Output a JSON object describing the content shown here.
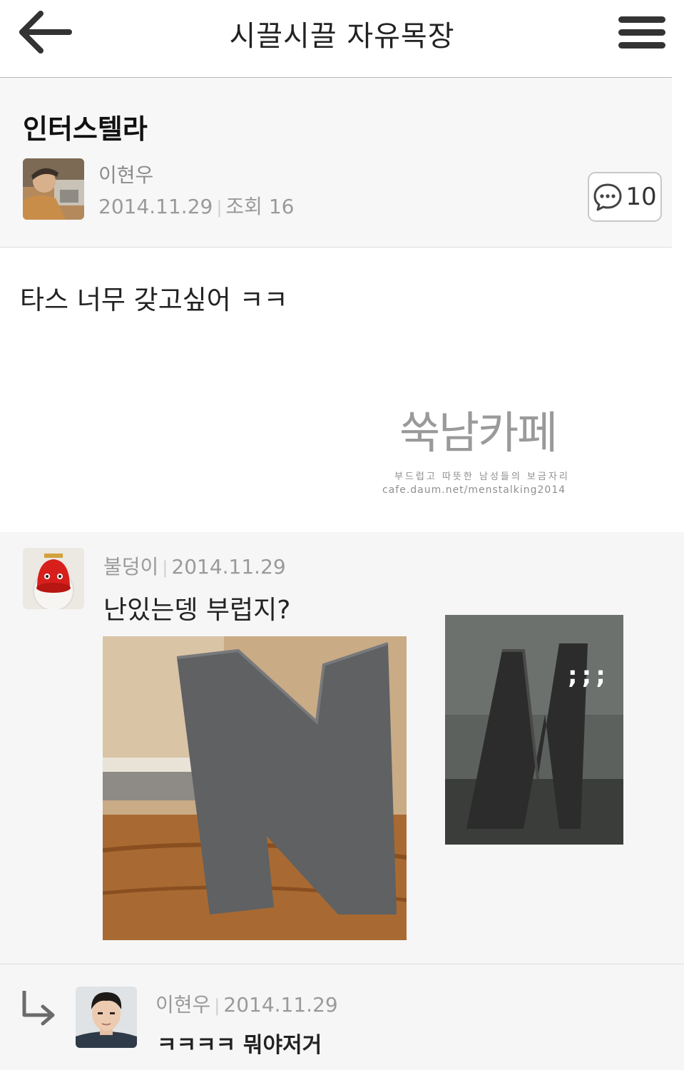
{
  "header": {
    "title": "시끌시끌 자유목장",
    "back_icon": "arrow-left-icon",
    "menu_icon": "hamburger-menu-icon"
  },
  "post": {
    "title": "인터스텔라",
    "author": "이현우",
    "date": "2014.11.29",
    "views_label": "조회 16",
    "comment_count": "10",
    "body": "타스 너무 갖고싶어 ㅋㅋ",
    "watermark": {
      "logo": "쑥남카페",
      "slogan": "부드럽고 따뜻한 남성들의 보금자리",
      "url": "cafe.daum.net/menstalking2014"
    }
  },
  "comments": [
    {
      "author": "불덩이",
      "date": "2014.11.29",
      "text": "난있는뎅 부럽지?",
      "image_caption": ";;;"
    }
  ],
  "replies": [
    {
      "author": "이현우",
      "date": "2014.11.29",
      "text": "ㅋㅋㅋㅋ 뭐야저거"
    }
  ],
  "colors": {
    "header_bg": "#ffffff",
    "post_head_bg": "#f7f7f7",
    "comments_bg": "#f6f6f6",
    "meta_text": "#9a9a9a"
  }
}
